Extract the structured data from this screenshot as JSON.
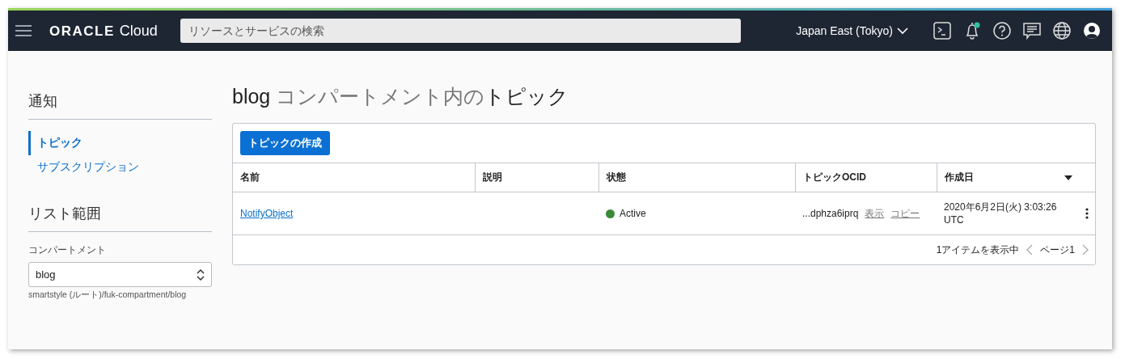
{
  "header": {
    "logo_brand": "ORACLE",
    "logo_product": "Cloud",
    "search": {
      "placeholder": "リソースとサービスの検索"
    },
    "region": "Japan East (Tokyo)",
    "notifications_unread": true
  },
  "sidebar": {
    "title": "通知",
    "items": [
      {
        "label": "トピック",
        "selected": true
      },
      {
        "label": "サブスクリプション",
        "selected": false
      }
    ],
    "scope_title": "リスト範囲",
    "compartment_label": "コンパートメント",
    "compartment_value": "blog",
    "compartment_path": "smartstyle (ルート)/fuk-compartment/blog"
  },
  "main": {
    "title_name": "blog",
    "title_middle": "コンパートメント内の",
    "title_end": "トピック",
    "create_button": "トピックの作成",
    "table": {
      "columns": [
        {
          "label": "名前",
          "sorted": false
        },
        {
          "label": "説明",
          "sorted": false
        },
        {
          "label": "状態",
          "sorted": false
        },
        {
          "label": "トピックOCID",
          "sorted": false
        },
        {
          "label": "作成日",
          "sorted": true
        }
      ],
      "rows": [
        {
          "name": "NotifyObject",
          "status": "Active",
          "color": "#3a8a3a",
          "ocid": "...dphza6iprq",
          "ocid_show": "表示",
          "ocid_copy": "コピー",
          "created": "2020年6月2日(火) 3:03:26 UTC"
        }
      ]
    },
    "footer": {
      "count": "1アイテムを表示中",
      "page": "ページ1"
    }
  }
}
